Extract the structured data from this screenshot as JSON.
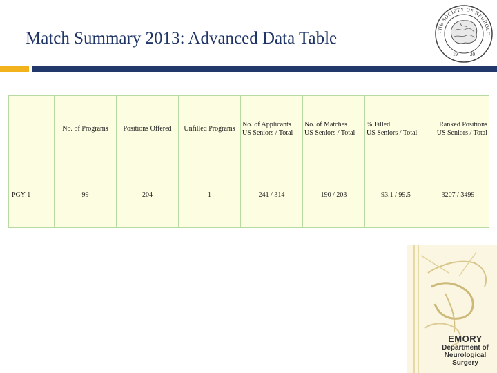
{
  "slide": {
    "title": "Match Summary 2013: Advanced Data Table"
  },
  "table": {
    "headers": [
      {
        "line1": "No. of Programs",
        "line2": ""
      },
      {
        "line1": "Positions Offered",
        "line2": ""
      },
      {
        "line1": "Unfilled Programs",
        "line2": ""
      },
      {
        "line1": "No. of Applicants",
        "line2": "US Seniors / Total"
      },
      {
        "line1": "No. of Matches",
        "line2": "US Seniors / Total"
      },
      {
        "line1": "% Filled",
        "line2": "US Seniors / Total"
      },
      {
        "line1": "Ranked Positions",
        "line2": "US Seniors / Total"
      }
    ],
    "row": {
      "label": "PGY-1",
      "cells": [
        "99",
        "204",
        "1",
        "241 / 314",
        "190 / 203",
        "93.1 / 99.5",
        "3207 / 3499"
      ]
    }
  },
  "seal": {
    "text": "THE SOCIETY OF NEUROLOGICAL SURGEONS",
    "year_left": "19",
    "year_right": "20"
  },
  "logo": {
    "line1": "EMORY",
    "line2": "Department of",
    "line3": "Neurological",
    "line4": "Surgery"
  },
  "colors": {
    "title": "#1f3566",
    "accent_gold": "#f2b21b",
    "accent_navy": "#22386b",
    "table_bg": "#fdfde1",
    "table_border": "#b7d9a2"
  }
}
